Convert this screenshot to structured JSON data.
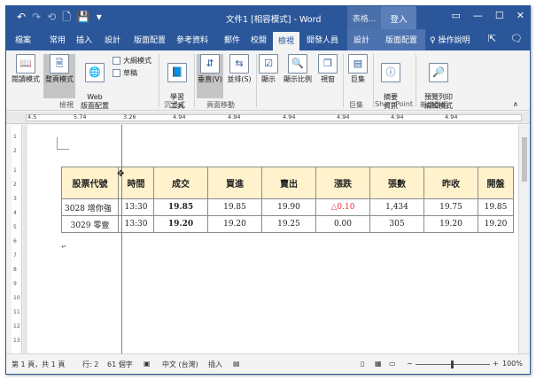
{
  "titlebar": {
    "qat": [
      "↶",
      "↷",
      "⟲",
      "🗋",
      "💾",
      "▾"
    ],
    "title": "文件1 [相容模式] - Word",
    "context_group": "表格...",
    "signin": "登入",
    "window_buttons": [
      "▭",
      "—",
      "☐",
      "✕"
    ]
  },
  "tabs": {
    "items": [
      "檔案",
      "常用",
      "插入",
      "設計",
      "版面配置",
      "參考資料",
      "郵件",
      "校閱",
      "檢視",
      "開發人員",
      "設計",
      "版面配置"
    ],
    "active": "檢視",
    "tell_me": "♀ 操作說明",
    "icons": [
      "⇱",
      "🗨"
    ]
  },
  "ribbon": {
    "buttons": [
      {
        "label": "閱讀模式",
        "icon": "📖"
      },
      {
        "label": "整頁模式",
        "icon": "🗎"
      },
      {
        "label": "Web\n版面配置",
        "icon": "🌐"
      },
      {
        "label": "大綱模式",
        "icon": "≡"
      },
      {
        "label": "草稿",
        "icon": "≣"
      },
      {
        "label": "學習\n工具",
        "icon": "📘"
      },
      {
        "label": "垂直(V)",
        "icon": "⇵"
      },
      {
        "label": "並排(S)",
        "icon": "⇆"
      },
      {
        "label": "顯示",
        "icon": "☑"
      },
      {
        "label": "顯示比例",
        "icon": "🔍"
      },
      {
        "label": "視窗",
        "icon": "❐"
      },
      {
        "label": "巨集",
        "icon": "▤"
      },
      {
        "label": "摘要\n資訊",
        "icon": "ⓘ"
      },
      {
        "label": "預覽列印\n編輯模式",
        "icon": "🔎"
      }
    ],
    "groups": [
      "檢視",
      "沉浸式",
      "頁面移動",
      "巨集",
      "SharePoint",
      "新增群組"
    ]
  },
  "ruler": {
    "labels": [
      "4.5",
      "5.74",
      "3.26",
      "4.94",
      "4.94",
      "4.94",
      "4.94",
      "4.94",
      "4.94"
    ],
    "vnums": [
      "1",
      "2",
      "1",
      "2",
      "3",
      "4",
      "5",
      "6",
      "7",
      "8",
      "9",
      "10",
      "11",
      "12",
      "13"
    ]
  },
  "table": {
    "headers": [
      "股票代號",
      "時間",
      "成交",
      "買進",
      "賣出",
      "漲跌",
      "張數",
      "昨收",
      "開盤"
    ],
    "rows": [
      [
        "3028 增你強",
        "13:30",
        "19.85",
        "19.85",
        "19.90",
        "△0.10",
        "1,434",
        "19.75",
        "19.85"
      ],
      [
        "3029 零壹",
        "13:30",
        "19.20",
        "19.20",
        "19.25",
        "0.00",
        "305",
        "19.20",
        "19.20"
      ]
    ]
  },
  "colors": {
    "accent": "#2b579a",
    "header_fill": "#fff2cc",
    "up": "#e03131"
  },
  "status": {
    "page": "第 1 頁，共 1 頁",
    "line": "行: 2",
    "words": "61 個字",
    "lang": "中文 (台灣)",
    "mode": "插入",
    "zoom": "100%",
    "zoom_minus": "−",
    "zoom_plus": "+"
  }
}
